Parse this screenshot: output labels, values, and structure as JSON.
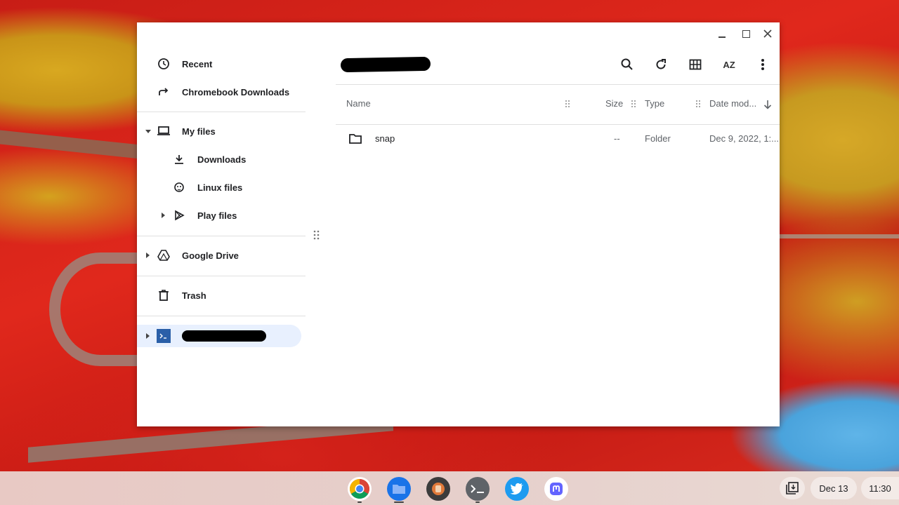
{
  "window": {
    "controls": {
      "minimize": "minimize",
      "maximize": "maximize",
      "close": "close"
    }
  },
  "sidebar": {
    "items": [
      {
        "label": "Recent",
        "icon": "clock-icon"
      },
      {
        "label": "Chromebook Downloads",
        "icon": "shortcut-arrow-icon"
      },
      {
        "label": "My files",
        "icon": "laptop-icon",
        "expanded": true
      },
      {
        "label": "Downloads",
        "icon": "download-icon"
      },
      {
        "label": "Linux files",
        "icon": "linux-penguin-icon"
      },
      {
        "label": "Play files",
        "icon": "play-store-icon"
      },
      {
        "label": "Google Drive",
        "icon": "google-drive-icon"
      },
      {
        "label": "Trash",
        "icon": "trash-icon"
      },
      {
        "label": "",
        "icon": "terminal-icon",
        "selected": true,
        "redacted": true
      }
    ]
  },
  "toolbar": {
    "breadcrumb_redacted": true,
    "icons": [
      "search-icon",
      "refresh-icon",
      "grid-view-icon",
      "sort-az-icon",
      "more-vert-icon"
    ],
    "sort_label": "AZ"
  },
  "table": {
    "columns": [
      "Name",
      "Size",
      "Type",
      "Date mod..."
    ],
    "rows": [
      {
        "name": "snap",
        "size": "--",
        "type": "Folder",
        "date": "Dec 9, 2022, 1:..."
      }
    ]
  },
  "shelf": {
    "apps": [
      "chrome-icon",
      "files-icon",
      "app-icon",
      "terminal-icon",
      "twitter-icon",
      "mastodon-icon"
    ],
    "date": "Dec 13",
    "time": "11:30"
  },
  "colors": {
    "accent": "#1a73e8",
    "selected_bg": "#e8f0fe"
  }
}
